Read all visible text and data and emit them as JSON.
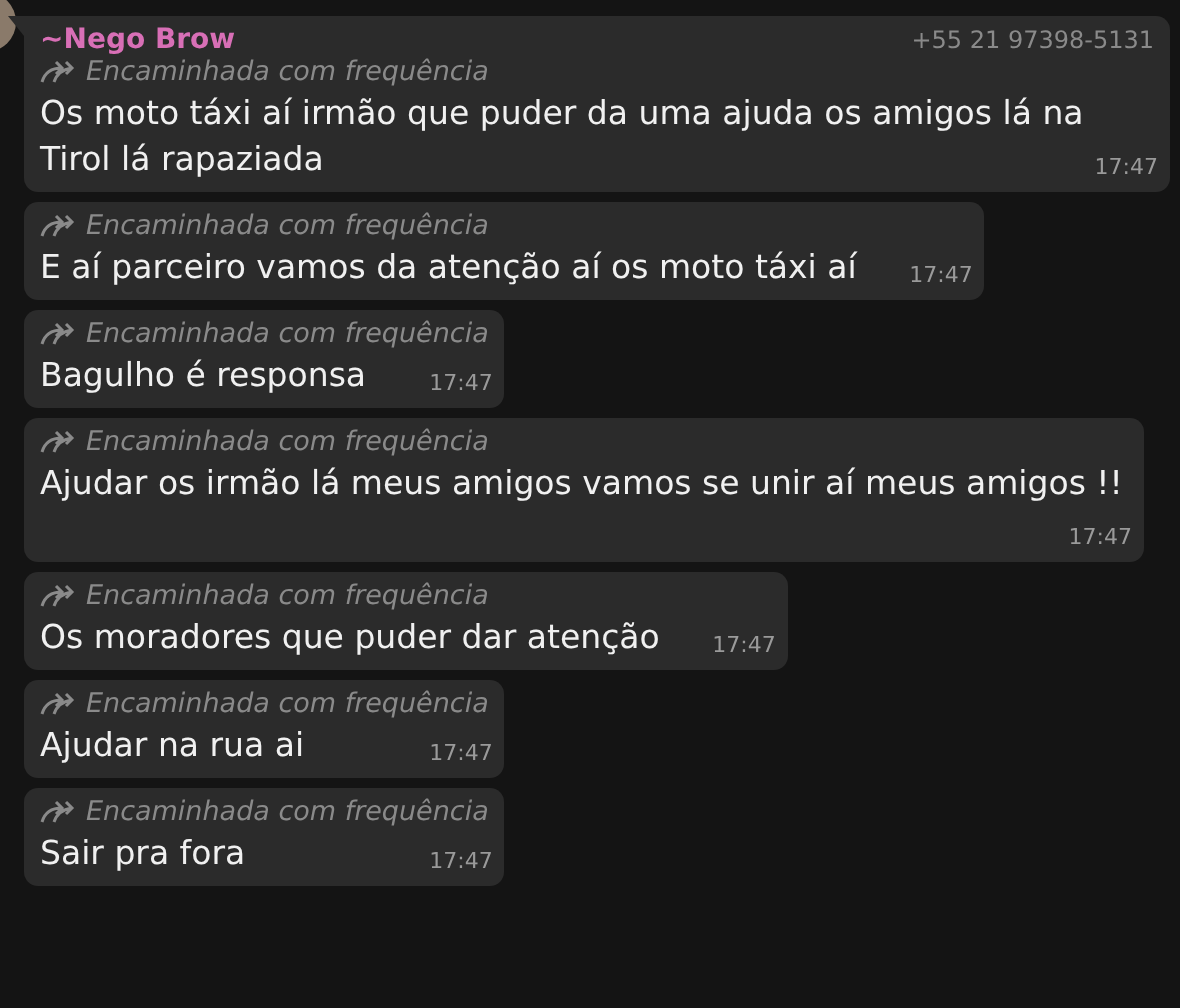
{
  "messages": [
    {
      "sender": "~Nego Brow",
      "phone": "+55 21 97398-5131",
      "forwarded": "Encaminhada com frequência",
      "text": "Os moto táxi aí irmão que puder da uma ajuda os amigos lá na Tirol lá rapaziada",
      "time": "17:47"
    },
    {
      "forwarded": "Encaminhada com frequência",
      "text": "E aí parceiro vamos da atenção aí os moto táxi aí",
      "time": "17:47"
    },
    {
      "forwarded": "Encaminhada com frequência",
      "text": "Bagulho é responsa",
      "time": "17:47"
    },
    {
      "forwarded": "Encaminhada com frequência",
      "text": "Ajudar os irmão lá meus amigos vamos se unir aí meus amigos !!",
      "time": "17:47"
    },
    {
      "forwarded": "Encaminhada com frequência",
      "text": "Os moradores que puder dar atenção",
      "time": "17:47"
    },
    {
      "forwarded": "Encaminhada com frequência",
      "text": "Ajudar na rua ai",
      "time": "17:47"
    },
    {
      "forwarded": "Encaminhada com frequência",
      "text": "Sair pra fora",
      "time": "17:47"
    }
  ]
}
